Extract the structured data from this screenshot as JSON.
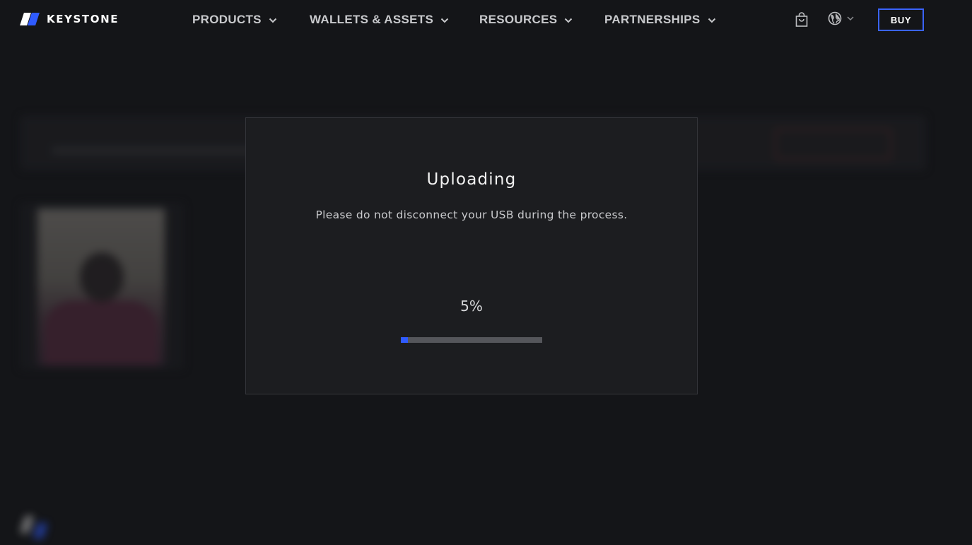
{
  "brand": {
    "name": "KEYSTONE",
    "accent_color": "#2f5bff"
  },
  "nav": {
    "items": [
      {
        "label": "PRODUCTS",
        "icon": "chevron-down-icon"
      },
      {
        "label": "WALLETS & ASSETS",
        "icon": "chevron-down-icon"
      },
      {
        "label": "RESOURCES",
        "icon": "chevron-down-icon"
      },
      {
        "label": "PARTNERSHIPS",
        "icon": "chevron-down-icon"
      }
    ],
    "cart_icon": "shopping-bag-icon",
    "language_icon": "globe-icon",
    "buy_label": "BUY"
  },
  "modal": {
    "title": "Uploading",
    "subtitle": "Please do not disconnect your USB during the process.",
    "progress_label": "5%",
    "progress_value": 0.05,
    "progress_fill_color": "#2f5bff",
    "track_color": "#55565b"
  }
}
